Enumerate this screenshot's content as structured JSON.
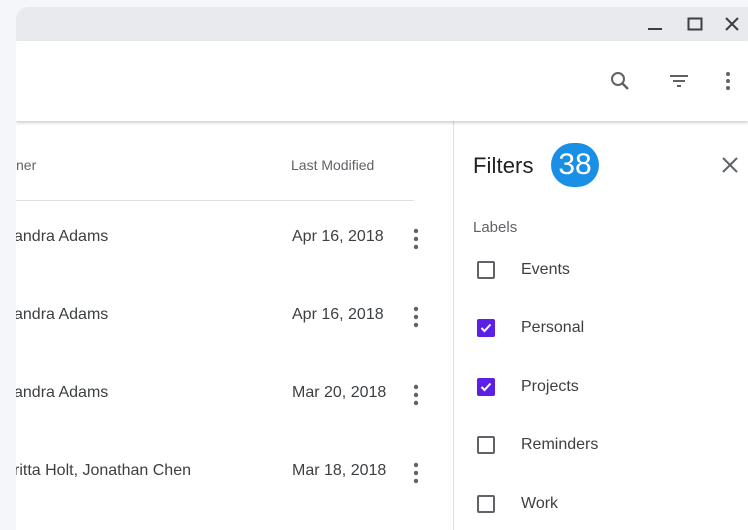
{
  "window": {
    "controls": {
      "minimize": "minimize-icon",
      "maximize": "maximize-icon",
      "close": "close-icon"
    }
  },
  "appbar": {
    "icons": [
      "search-icon",
      "filter-icon",
      "more-vert-icon"
    ]
  },
  "files": {
    "columns": {
      "owner": "ner",
      "modified": "Last Modified"
    },
    "rows": [
      {
        "owner": "andra Adams",
        "date": "Apr 16, 2018"
      },
      {
        "owner": "andra Adams",
        "date": "Apr 16, 2018"
      },
      {
        "owner": "andra Adams",
        "date": "Mar 20, 2018"
      },
      {
        "owner": "ritta Holt, Jonathan Chen",
        "date": "Mar 18, 2018"
      }
    ]
  },
  "filters": {
    "title": "Filters",
    "badge": "38",
    "section_label": "Labels",
    "options": [
      {
        "label": "Events",
        "checked": false
      },
      {
        "label": "Personal",
        "checked": true
      },
      {
        "label": "Projects",
        "checked": true
      },
      {
        "label": "Reminders",
        "checked": false
      },
      {
        "label": "Work",
        "checked": false
      }
    ]
  },
  "colors": {
    "accent": "#5b1fe6",
    "badge": "#1a8fe6",
    "titlebar": "#e8eaed"
  }
}
